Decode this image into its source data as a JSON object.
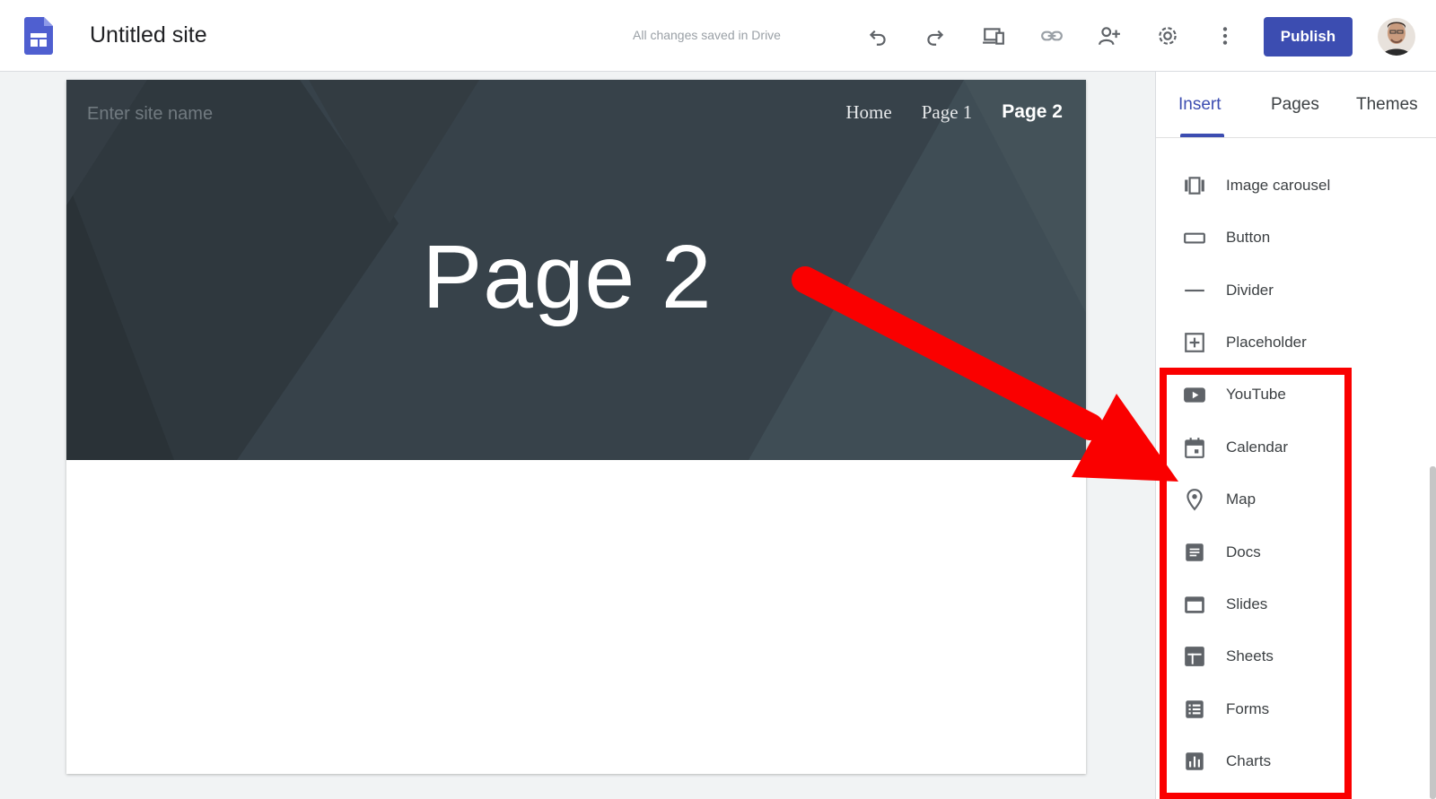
{
  "header": {
    "site_title": "Untitled site",
    "save_status": "All changes saved in Drive",
    "publish_label": "Publish",
    "toolbar_icons": [
      "undo-icon",
      "redo-icon",
      "preview-devices-icon",
      "link-icon",
      "add-person-icon",
      "settings-icon",
      "more-vert-icon"
    ]
  },
  "canvas": {
    "site_name_placeholder": "Enter site name",
    "nav": [
      "Home",
      "Page 1",
      "Page 2"
    ],
    "active_nav": "Page 2",
    "page_title": "Page 2"
  },
  "panel": {
    "tabs": [
      "Insert",
      "Pages",
      "Themes"
    ],
    "active_tab": "Insert",
    "items": [
      {
        "label": "Image carousel",
        "icon": "image-carousel-icon"
      },
      {
        "label": "Button",
        "icon": "button-icon"
      },
      {
        "label": "Divider",
        "icon": "divider-icon"
      },
      {
        "label": "Placeholder",
        "icon": "placeholder-icon"
      },
      {
        "label": "YouTube",
        "icon": "youtube-icon"
      },
      {
        "label": "Calendar",
        "icon": "calendar-icon"
      },
      {
        "label": "Map",
        "icon": "map-pin-icon"
      },
      {
        "label": "Docs",
        "icon": "docs-icon"
      },
      {
        "label": "Slides",
        "icon": "slides-icon"
      },
      {
        "label": "Sheets",
        "icon": "sheets-icon"
      },
      {
        "label": "Forms",
        "icon": "forms-icon"
      },
      {
        "label": "Charts",
        "icon": "charts-icon"
      }
    ]
  },
  "colors": {
    "accent": "#3c4db1",
    "hero_bg": "#37424a",
    "annotation": "#fa0000",
    "icon_gray": "#5f6368"
  }
}
